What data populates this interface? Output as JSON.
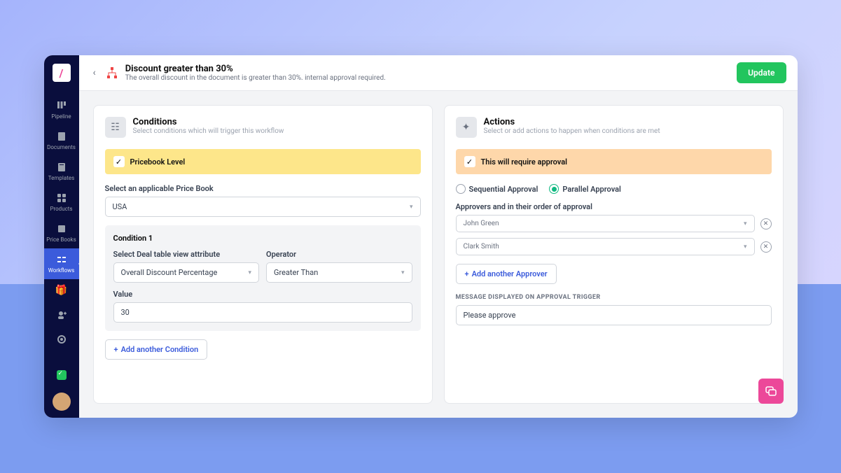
{
  "sidebar": {
    "items": [
      {
        "label": "Pipeline"
      },
      {
        "label": "Documents"
      },
      {
        "label": "Templates"
      },
      {
        "label": "Products"
      },
      {
        "label": "Price Books"
      },
      {
        "label": "Workflows"
      }
    ]
  },
  "header": {
    "title": "Discount greater than 30%",
    "subtitle": "The overall discount in the document is greater than 30%. internal approval required.",
    "update_label": "Update"
  },
  "conditions": {
    "title": "Conditions",
    "subtitle": "Select conditions which will trigger this workflow",
    "banner_label": "Pricebook Level",
    "pricebook_label": "Select an applicable Price Book",
    "pricebook_value": "USA",
    "condition1": {
      "title": "Condition 1",
      "attr_label": "Select Deal table view attribute",
      "attr_value": "Overall Discount Percentage",
      "op_label": "Operator",
      "op_value": "Greater Than",
      "value_label": "Value",
      "value": "30"
    },
    "add_label": "Add another Condition"
  },
  "actions": {
    "title": "Actions",
    "subtitle": "Select or add actions to happen when conditions are met",
    "banner_label": "This will require approval",
    "sequential_label": "Sequential Approval",
    "parallel_label": "Parallel Approval",
    "approvers_label": "Approvers and in their order of approval",
    "approvers": [
      "John Green",
      "Clark Smith"
    ],
    "add_approver_label": "Add another Approver",
    "message_section": "MESSAGE DISPLAYED ON APPROVAL TRIGGER",
    "message_value": "Please approve"
  }
}
